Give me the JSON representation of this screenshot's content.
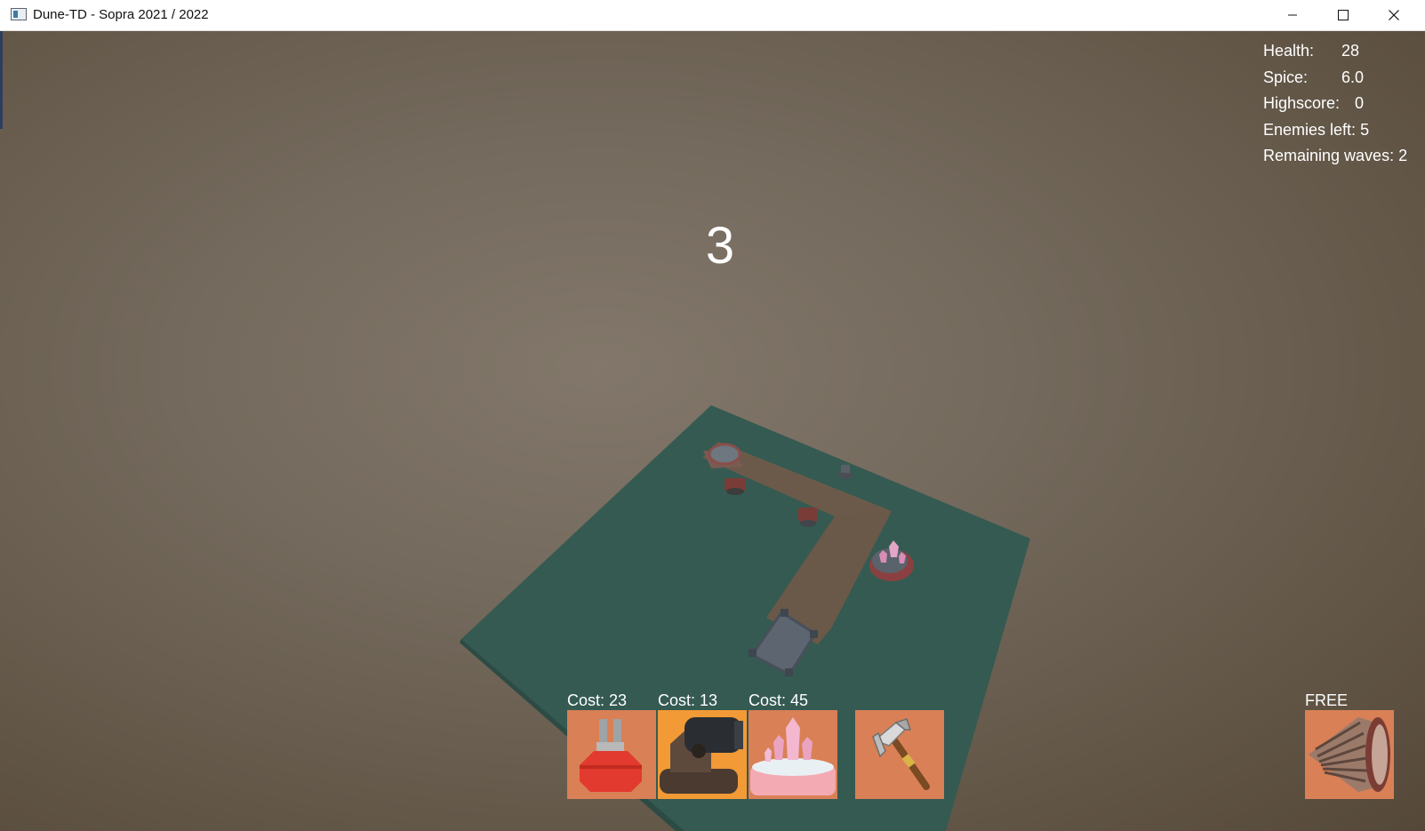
{
  "window": {
    "title": "Dune-TD - Sopra 2021 / 2022"
  },
  "hud": {
    "health_label": "Health:",
    "health_value": "28",
    "spice_label": "Spice:",
    "spice_value": "6.0",
    "highscore_label": "Highscore:",
    "highscore_value": "0",
    "enemies_label": "Enemies left:",
    "enemies_value": "5",
    "waves_label": "Remaining waves:",
    "waves_value": "2"
  },
  "countdown": "3",
  "toolbar": {
    "towers": [
      {
        "cost_label": "Cost: 23",
        "icon": "red-tower-icon"
      },
      {
        "cost_label": "Cost: 13",
        "icon": "cannon-tower-icon",
        "selected": true
      },
      {
        "cost_label": "Cost: 45",
        "icon": "crystal-tower-icon"
      }
    ],
    "hammer": {
      "icon": "hammer-icon"
    },
    "drill": {
      "cost_label": "FREE",
      "icon": "drill-icon"
    }
  },
  "colors": {
    "slot_bg": "#d98056",
    "slot_selected_bg": "#f29a36",
    "board": "#355a52",
    "path": "#6b5a4a"
  }
}
